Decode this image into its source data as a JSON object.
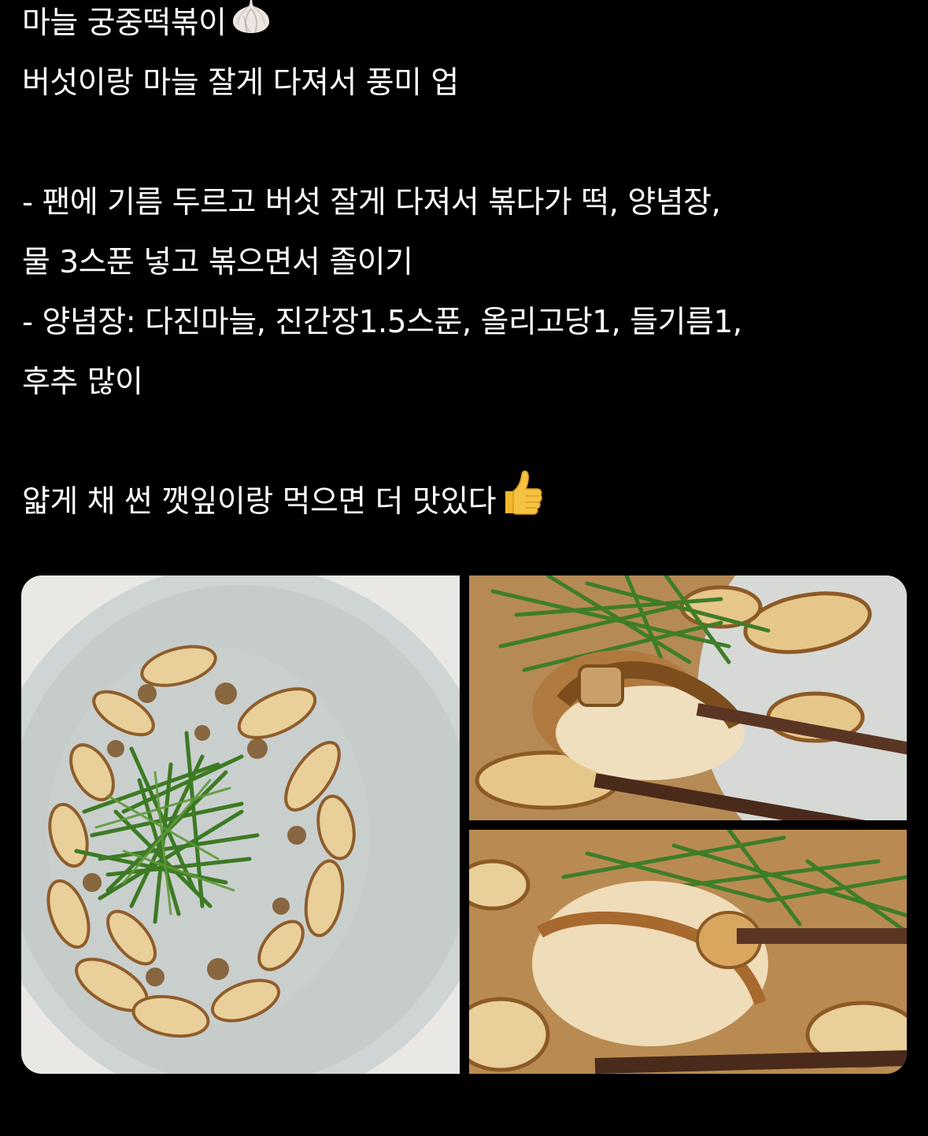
{
  "post": {
    "lines": [
      "마늘 궁중떡볶이",
      "버섯이랑 마늘 잘게 다져서 풍미 업",
      "",
      "- 팬에 기름 두르고 버섯 잘게 다져서 볶다가 떡, 양념장,",
      "물 3스푼 넣고 볶으면서 졸이기",
      "- 양념장: 다진마늘, 진간장1.5스푼, 올리고당1, 들기름1,",
      "후추 많이",
      "",
      "얇게 채 썬 깻잎이랑 먹으면 더 맛있다"
    ],
    "title_emoji": "garlic-icon",
    "closing_emoji": "thumbs-up-icon"
  },
  "media": {
    "count": 3,
    "items": [
      {
        "icon": "photo-plate-overhead"
      },
      {
        "icon": "photo-chopsticks-closeup"
      },
      {
        "icon": "photo-chopsticks-closeup-2"
      }
    ]
  },
  "colors": {
    "background": "#000000",
    "text": "#ffffff",
    "plate": "#c9d0cf",
    "rice_cake": "#efd9a8",
    "sauce": "#8a5a2b",
    "perilla": "#3f7a2a",
    "chopstick": "#4a2a1b"
  }
}
